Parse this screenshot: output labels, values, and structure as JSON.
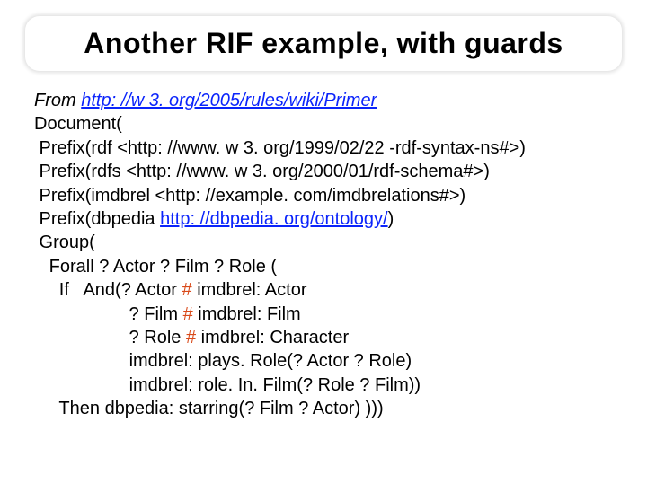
{
  "title": "Another RIF example, with guards",
  "from_label": "From ",
  "from_link": "http: //w 3. org/2005/rules/wiki/Primer",
  "code": {
    "l1": "Document(",
    "l2": " Prefix(rdf <http: //www. w 3. org/1999/02/22 -rdf-syntax-ns#>)",
    "l3": " Prefix(rdfs <http: //www. w 3. org/2000/01/rdf-schema#>)",
    "l4": " Prefix(imdbrel <http: //example. com/imdbrelations#>)",
    "l5a": " Prefix(dbpedia ",
    "l5_link": "http: //dbpedia. org/ontology/",
    "l5b": ")",
    "l6": " Group(",
    "l7": "   Forall ? Actor ? Film ? Role (",
    "l8a": "     If   And(? Actor ",
    "l8b": " imdbrel: Actor",
    "l9a": "                   ? Film ",
    "l9b": " imdbrel: Film",
    "l10a": "                   ? Role ",
    "l10b": " imdbrel: Character",
    "l11": "                   imdbrel: plays. Role(? Actor ? Role)",
    "l12": "                   imdbrel: role. In. Film(? Role ? Film))",
    "l13": "     Then dbpedia: starring(? Film ? Actor) )))",
    "hash": "#"
  }
}
